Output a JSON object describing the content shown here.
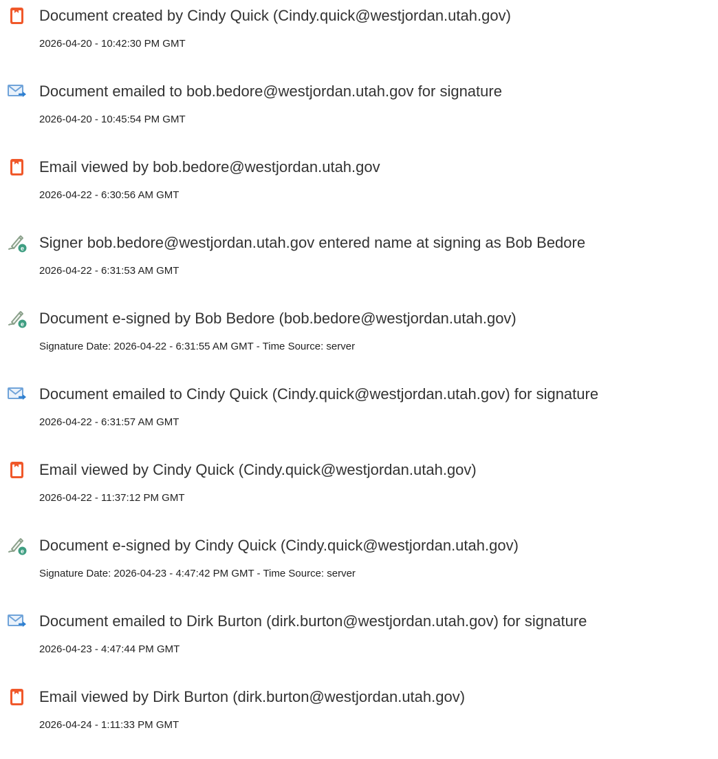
{
  "colors": {
    "doc_icon": "#f0582a",
    "email_icon": "#6fa3d9",
    "email_arrow": "#2d7fd1",
    "sign_icon": "#8aa08a",
    "sign_badge": "#3f9e82",
    "text": "#333333"
  },
  "events": [
    {
      "icon": "document-icon",
      "title": "Document created by Cindy Quick (Cindy.quick@westjordan.utah.gov)",
      "time": "2026-04-20 - 10:42:30 PM GMT"
    },
    {
      "icon": "email-icon",
      "title": "Document emailed to bob.bedore@westjordan.utah.gov for signature",
      "time": "2026-04-20 - 10:45:54 PM GMT"
    },
    {
      "icon": "document-icon",
      "title": "Email viewed by bob.bedore@westjordan.utah.gov",
      "time": "2026-04-22 - 6:30:56 AM GMT"
    },
    {
      "icon": "signature-pen-icon",
      "title": "Signer bob.bedore@westjordan.utah.gov entered name at signing as Bob Bedore",
      "time": "2026-04-22 - 6:31:53 AM GMT"
    },
    {
      "icon": "signature-pen-icon",
      "title": "Document e-signed by Bob Bedore (bob.bedore@westjordan.utah.gov)",
      "time": "Signature Date: 2026-04-22 - 6:31:55 AM GMT - Time Source: server"
    },
    {
      "icon": "email-icon",
      "title": "Document emailed to Cindy Quick (Cindy.quick@westjordan.utah.gov) for signature",
      "time": "2026-04-22 - 6:31:57 AM GMT"
    },
    {
      "icon": "document-icon",
      "title": "Email viewed by Cindy Quick (Cindy.quick@westjordan.utah.gov)",
      "time": "2026-04-22 - 11:37:12 PM GMT"
    },
    {
      "icon": "signature-pen-icon",
      "title": "Document e-signed by Cindy Quick (Cindy.quick@westjordan.utah.gov)",
      "time": "Signature Date: 2026-04-23 - 4:47:42 PM GMT - Time Source: server"
    },
    {
      "icon": "email-icon",
      "title": "Document emailed to Dirk Burton (dirk.burton@westjordan.utah.gov) for signature",
      "time": "2026-04-23 - 4:47:44 PM GMT"
    },
    {
      "icon": "document-icon",
      "title": "Email viewed by Dirk Burton (dirk.burton@westjordan.utah.gov)",
      "time": "2026-04-24 - 1:11:33 PM GMT"
    }
  ]
}
